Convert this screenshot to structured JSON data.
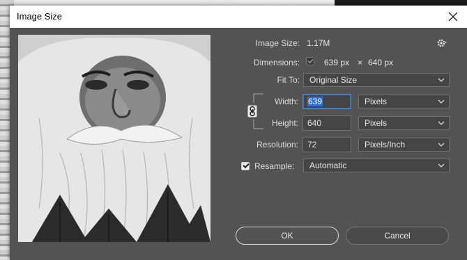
{
  "window": {
    "title": "Image Size"
  },
  "info": {
    "image_size_label": "Image Size:",
    "image_size_value": "1.17M",
    "dimensions_label": "Dimensions:",
    "dimensions_width": "639 px",
    "dimensions_times": "×",
    "dimensions_height": "640 px"
  },
  "fit_to": {
    "label": "Fit To:",
    "value": "Original Size"
  },
  "width": {
    "label": "Width:",
    "value": "639",
    "unit": "Pixels"
  },
  "height": {
    "label": "Height:",
    "value": "640",
    "unit": "Pixels"
  },
  "resolution": {
    "label": "Resolution:",
    "value": "72",
    "unit": "Pixels/Inch"
  },
  "resample": {
    "label": "Resample:",
    "checked": true,
    "value": "Automatic"
  },
  "buttons": {
    "ok": "OK",
    "cancel": "Cancel"
  },
  "icons": {
    "close": "close-icon",
    "settings": "gear-icon",
    "link": "link-icon",
    "chevron": "chevron-down-icon"
  },
  "colors": {
    "dialog_bg": "#535353",
    "focus": "#4d8ad6",
    "selection": "#2e6fd1"
  }
}
